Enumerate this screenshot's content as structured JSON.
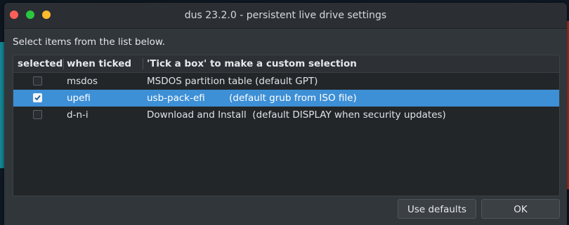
{
  "window": {
    "title": "dus 23.2.0 - persistent live drive settings",
    "traffic_lights": [
      "close",
      "maximize",
      "minimize"
    ]
  },
  "instruction": "Select items from the list below.",
  "table": {
    "columns": [
      "selected",
      "when ticked",
      "'Tick a box' to make a custom selection"
    ],
    "rows": [
      {
        "selected": false,
        "when_ticked": "msdos",
        "description": "MSDOS partition table (default GPT)"
      },
      {
        "selected": true,
        "when_ticked": "upefi",
        "description": "usb-pack-efi        (default grub from ISO file)"
      },
      {
        "selected": false,
        "when_ticked": "d-n-i",
        "description": "Download and Install  (default DISPLAY when security updates)"
      }
    ]
  },
  "buttons": {
    "use_defaults": "Use defaults",
    "ok": "OK"
  },
  "colors": {
    "selection": "#3d8fd6",
    "window_bg": "#31363b",
    "list_bg": "#232629"
  }
}
